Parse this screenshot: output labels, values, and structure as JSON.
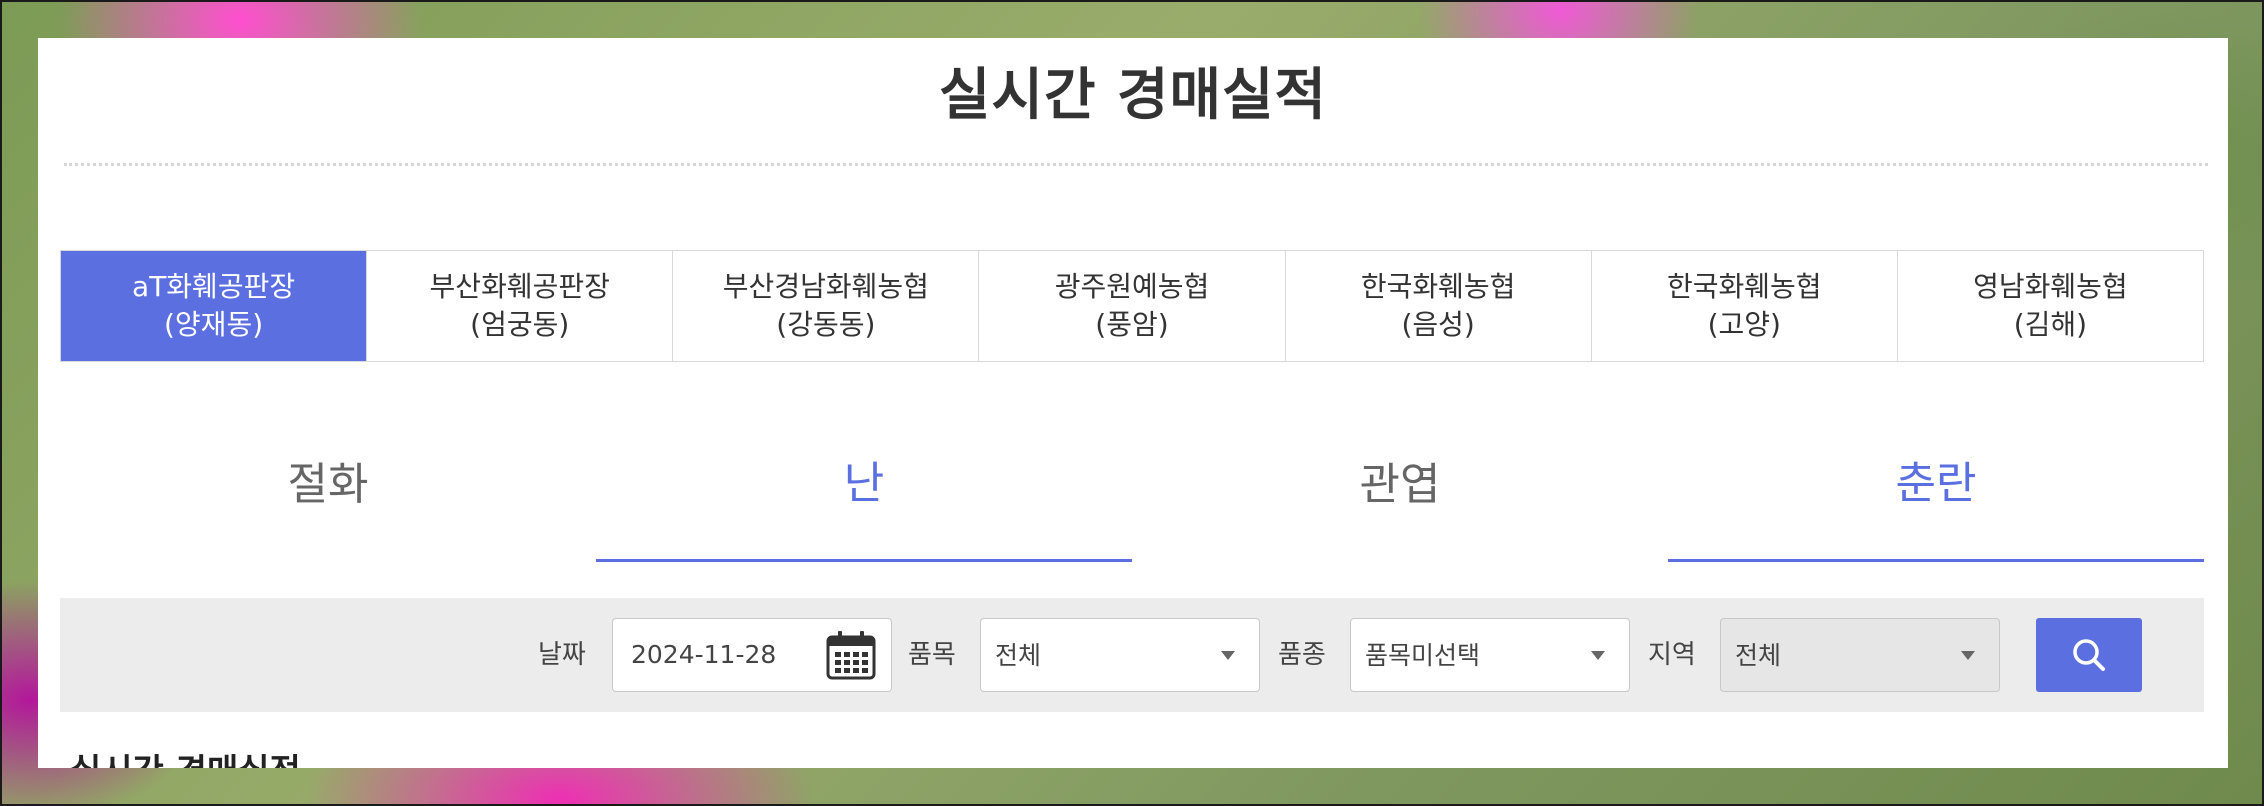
{
  "page": {
    "title": "실시간 경매실적",
    "next_heading": "실시간 경매실적"
  },
  "market_tabs": [
    {
      "line1": "aT화훼공판장",
      "line2": "(양재동)",
      "active": true
    },
    {
      "line1": "부산화훼공판장",
      "line2": "(엄궁동)",
      "active": false
    },
    {
      "line1": "부산경남화훼농협",
      "line2": "(강동동)",
      "active": false
    },
    {
      "line1": "광주원예농협",
      "line2": "(풍암)",
      "active": false
    },
    {
      "line1": "한국화훼농협",
      "line2": "(음성)",
      "active": false
    },
    {
      "line1": "한국화훼농협",
      "line2": "(고양)",
      "active": false
    },
    {
      "line1": "영남화훼농협",
      "line2": "(김해)",
      "active": false
    }
  ],
  "category_tabs": [
    {
      "label": "절화",
      "active": false
    },
    {
      "label": "난",
      "active": true
    },
    {
      "label": "관엽",
      "active": false
    },
    {
      "label": "춘란",
      "active": true
    }
  ],
  "search": {
    "date_label": "날짜",
    "date_value": "2024-11-28",
    "item_label": "품목",
    "item_value": "전체",
    "variety_label": "품종",
    "variety_value": "품목미선택",
    "region_label": "지역",
    "region_value": "전체"
  },
  "colors": {
    "accent": "#5b6fe0",
    "search_bar_bg": "#ececec"
  },
  "icons": {
    "calendar": "calendar-icon",
    "search": "search-icon",
    "dropdown": "chevron-down-icon"
  }
}
